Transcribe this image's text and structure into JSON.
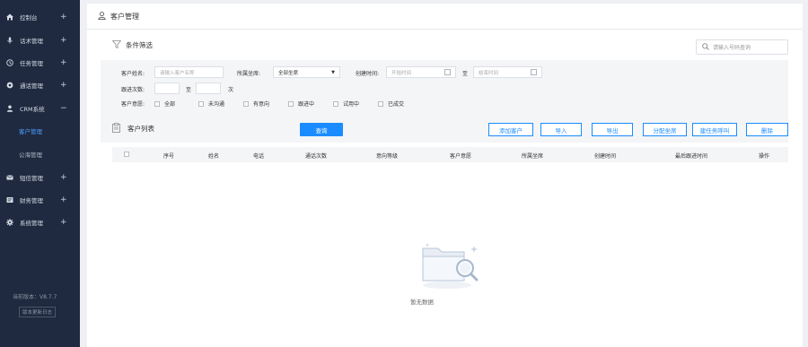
{
  "sidebar": {
    "items": [
      {
        "label": "控制台",
        "icon": "home-icon"
      },
      {
        "label": "话术管理",
        "icon": "microphone-icon"
      },
      {
        "label": "任务管理",
        "icon": "task-icon"
      },
      {
        "label": "通话管理",
        "icon": "call-icon"
      },
      {
        "label": "CRM系统",
        "icon": "user-icon"
      },
      {
        "label": "短信管理",
        "icon": "mail-icon"
      },
      {
        "label": "财务管理",
        "icon": "finance-icon"
      },
      {
        "label": "系统管理",
        "icon": "gear-icon"
      }
    ],
    "crm_sub": [
      "客户管理",
      "公海管理"
    ],
    "version": "当前版本：V8.7.7",
    "version_log": "版本更新日志"
  },
  "header": {
    "title": "客户管理"
  },
  "filter": {
    "title": "条件筛选",
    "search_placeholder": "请输入号码查询",
    "customer_name_label": "客户姓名:",
    "customer_name_placeholder": "请输入客户名称",
    "owner_label": "所属坐席:",
    "owner_value": "全部坐席",
    "created_label": "创建时间:",
    "start_placeholder": "开始时间",
    "to": "至",
    "end_placeholder": "结束时间",
    "followup_label": "跟进次数:",
    "followup_to": "至",
    "followup_unit": "次",
    "intent_label": "客户意愿:",
    "intents": [
      "全部",
      "未沟通",
      "有意向",
      "跟进中",
      "试用中",
      "已成交"
    ]
  },
  "list": {
    "title": "客户列表",
    "query_button": "查询",
    "actions": [
      "添加客户",
      "导入",
      "导出",
      "分配坐席",
      "建任务呼叫",
      "删除"
    ],
    "columns": [
      "序号",
      "姓名",
      "电话",
      "通话次数",
      "意向等级",
      "客户意愿",
      "所属坐席",
      "创建时间",
      "最后跟进时间",
      "操作"
    ],
    "empty_text": "暂无数据"
  },
  "colors": {
    "sidebar_bg": "#1f2a40",
    "accent": "#1a8cff",
    "active_sub": "#4f9dff"
  }
}
